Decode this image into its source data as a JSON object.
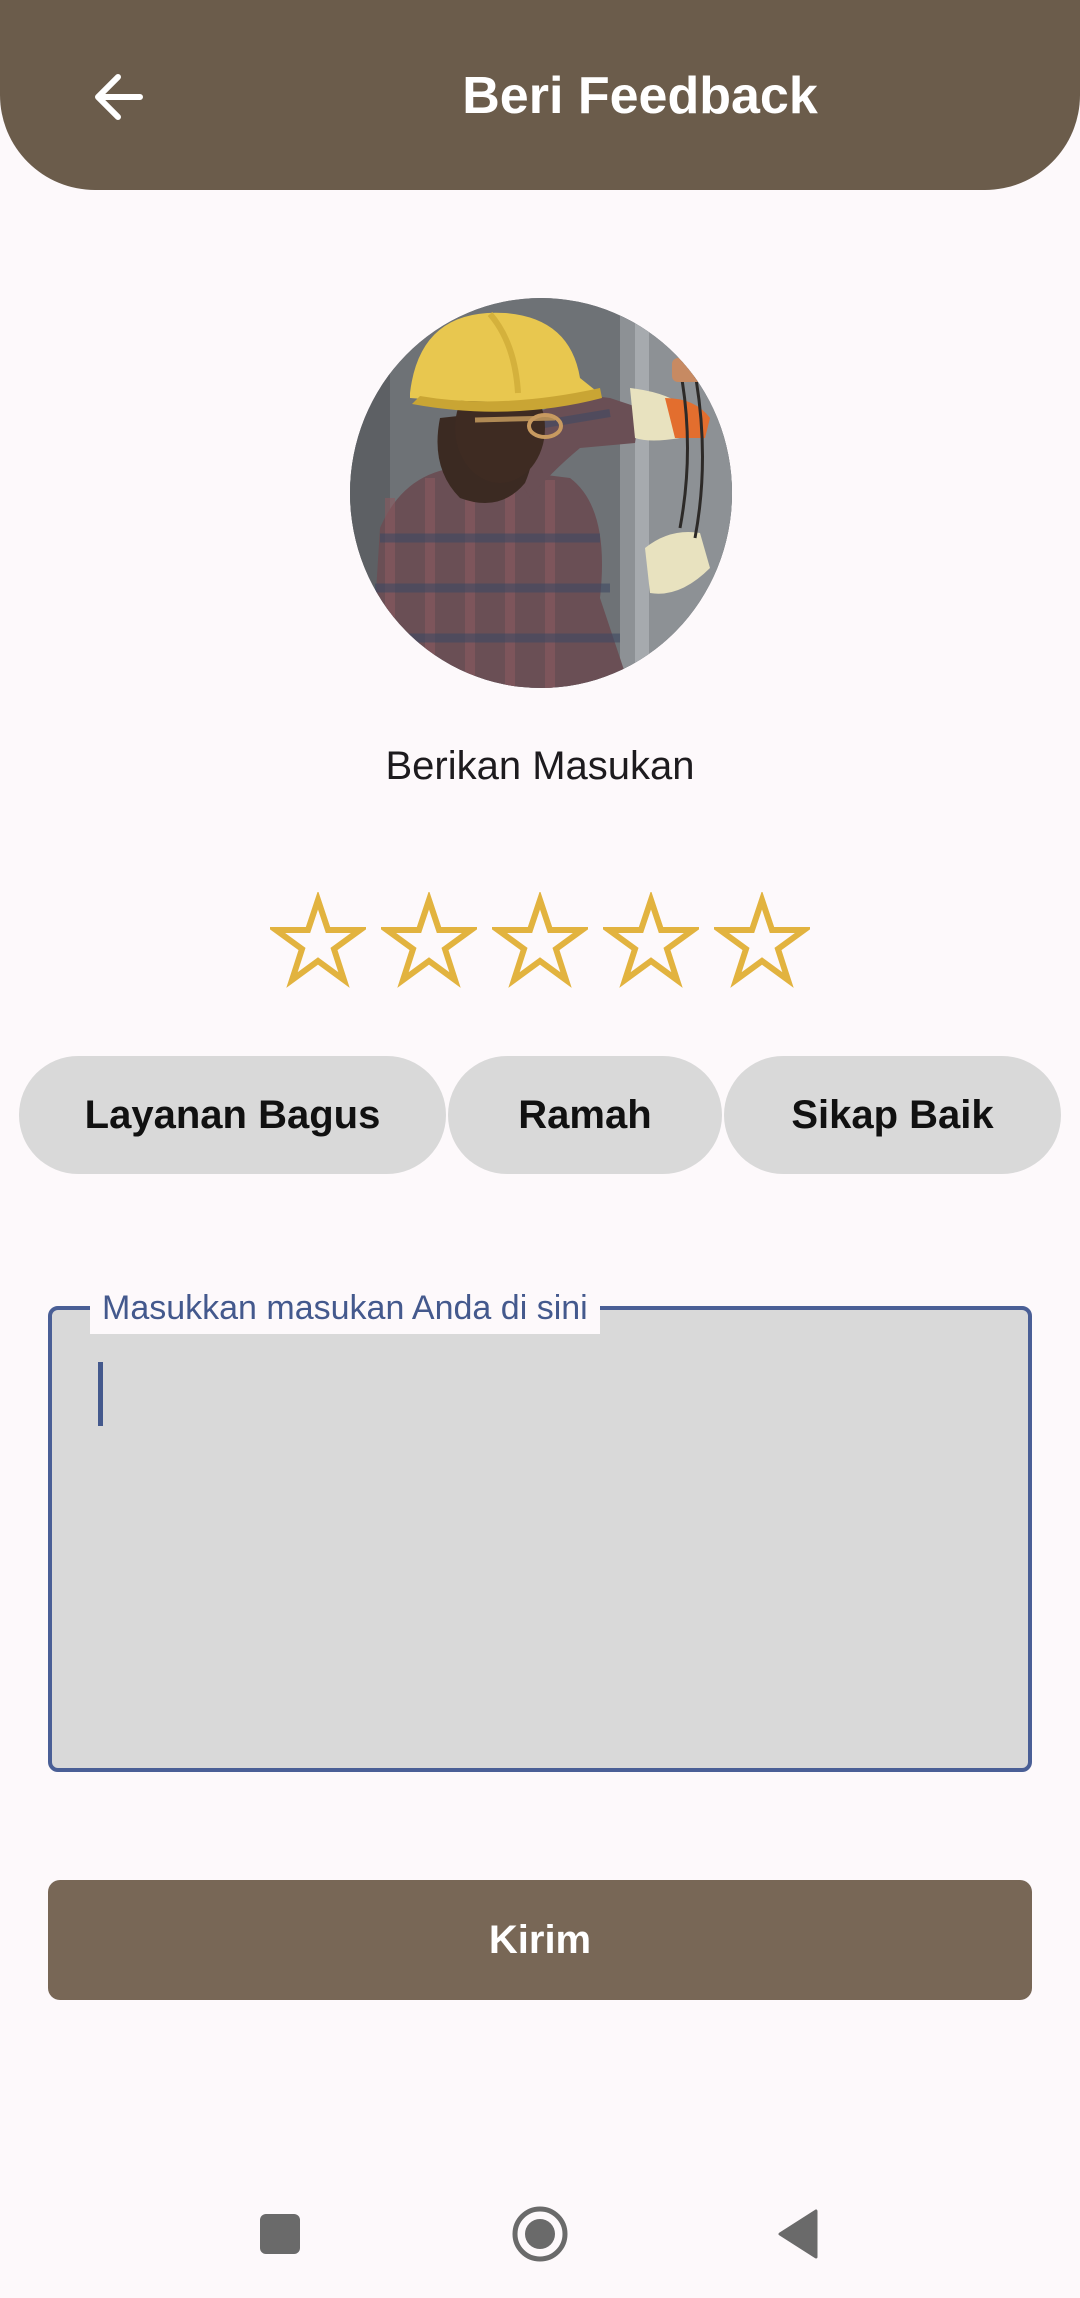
{
  "header": {
    "title": "Beri Feedback",
    "back_icon": "arrow-left-icon"
  },
  "profile": {
    "avatar_description_icon": "worker-photo",
    "subtitle": "Berikan Masukan"
  },
  "rating": {
    "max": 5,
    "value": 0,
    "star_color": "#e2b33f",
    "star_icon": "star-outline-icon"
  },
  "tags": [
    {
      "label": "Layanan Bagus"
    },
    {
      "label": "Ramah"
    },
    {
      "label": "Sikap Baik"
    }
  ],
  "feedback": {
    "label": "Masukkan masukan Anda di sini",
    "value": "",
    "border_color": "#4a5f96"
  },
  "submit": {
    "label": "Kirim"
  },
  "colors": {
    "appbar": "#6b5c4b",
    "button": "#786756",
    "chip": "#d9d9d9",
    "background": "#fdf9fb"
  },
  "system_nav": {
    "recents_icon": "square-icon",
    "home_icon": "circle-home-icon",
    "back_icon": "triangle-back-icon"
  }
}
